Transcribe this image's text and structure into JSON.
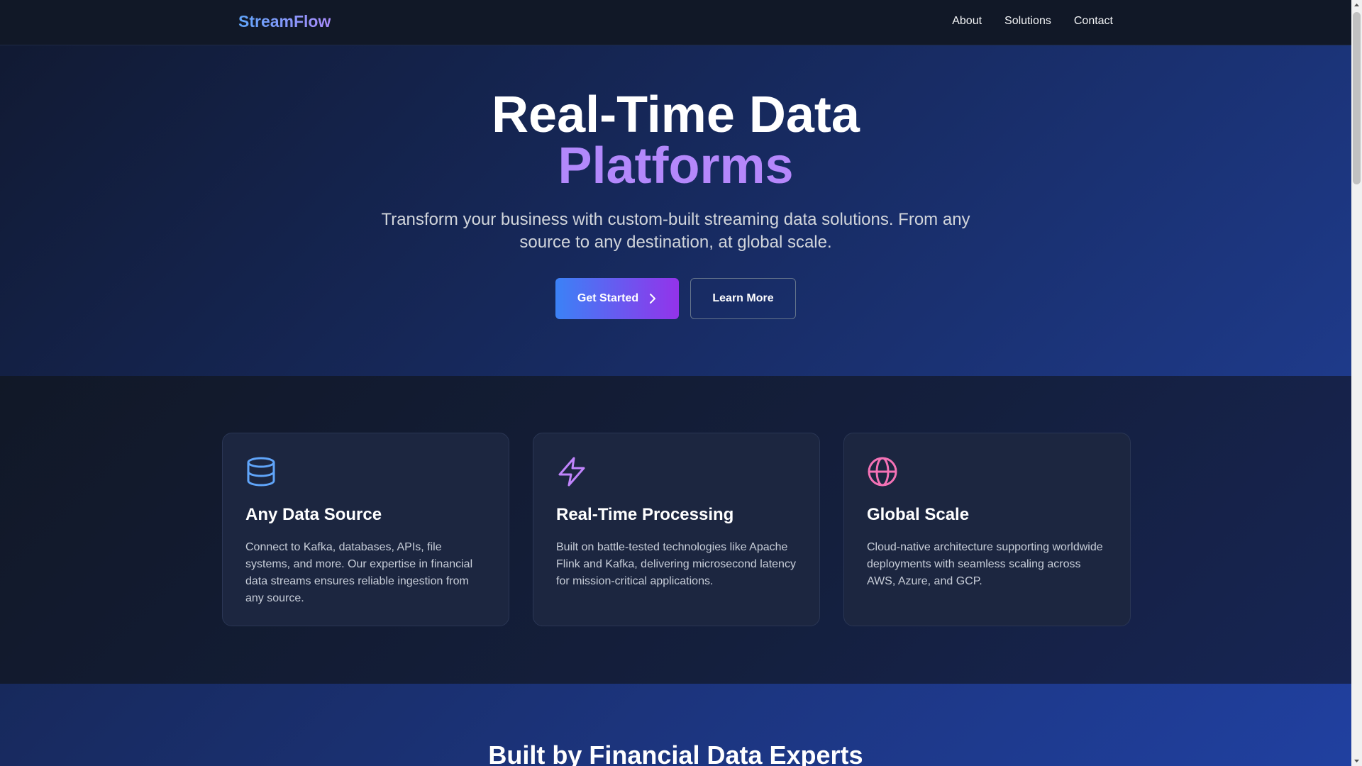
{
  "nav": {
    "brand": "StreamFlow",
    "links": [
      "About",
      "Solutions",
      "Contact"
    ]
  },
  "hero": {
    "title": "Real-Time Data",
    "title_accent": "Platforms",
    "subtitle": "Transform your business with custom-built streaming data solutions. From any source to any destination, at global scale.",
    "primary_button": "Get Started",
    "secondary_button": "Learn More"
  },
  "features": [
    {
      "icon": "database-icon",
      "title": "Any Data Source",
      "text": "Connect to Kafka, databases, APIs, file systems, and more. Our expertise in financial data streams ensures reliable ingestion from any source."
    },
    {
      "icon": "lightning-icon",
      "title": "Real-Time Processing",
      "text": "Built on battle-tested technologies like Apache Flink and Kafka, delivering microsecond latency for mission-critical applications."
    },
    {
      "icon": "globe-icon",
      "title": "Global Scale",
      "text": "Cloud-native architecture supporting worldwide deployments with seamless scaling across AWS, Azure, and GCP."
    }
  ],
  "experts": {
    "title": "Built by Financial Data Experts"
  },
  "colors": {
    "accent_blue": "#60a5fa",
    "accent_purple": "#a78bfa",
    "accent_pink": "#f472b6"
  }
}
